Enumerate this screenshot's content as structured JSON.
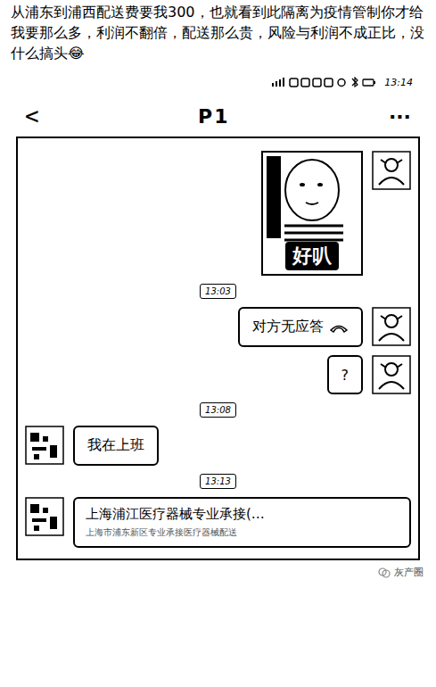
{
  "article": {
    "caption": "从浦东到浦西配送费要我300，也就看到此隔离为疫情管制你才给我要那么多，利润不翻倍，配送那么贵，风险与利润不成正比，没什么搞头😂",
    "watermark": "灰产圈"
  },
  "status_bar": {
    "time": "13:14"
  },
  "header": {
    "back": "<",
    "title": "P1",
    "more": "···"
  },
  "messages": [
    {
      "kind": "sticker",
      "side": "right",
      "text": "好叭"
    },
    {
      "kind": "time",
      "text": "13:03"
    },
    {
      "kind": "call",
      "side": "right",
      "text": "对方无应答"
    },
    {
      "kind": "text",
      "side": "right",
      "text": "?"
    },
    {
      "kind": "time",
      "text": "13:08"
    },
    {
      "kind": "text",
      "side": "left",
      "text": "我在上班"
    },
    {
      "kind": "time",
      "text": "13:13"
    },
    {
      "kind": "card",
      "side": "left",
      "text": "上海浦江医疗器械专业承接(…",
      "subtitle": "上海市浦东新区专业承接医疗器械配送"
    }
  ]
}
